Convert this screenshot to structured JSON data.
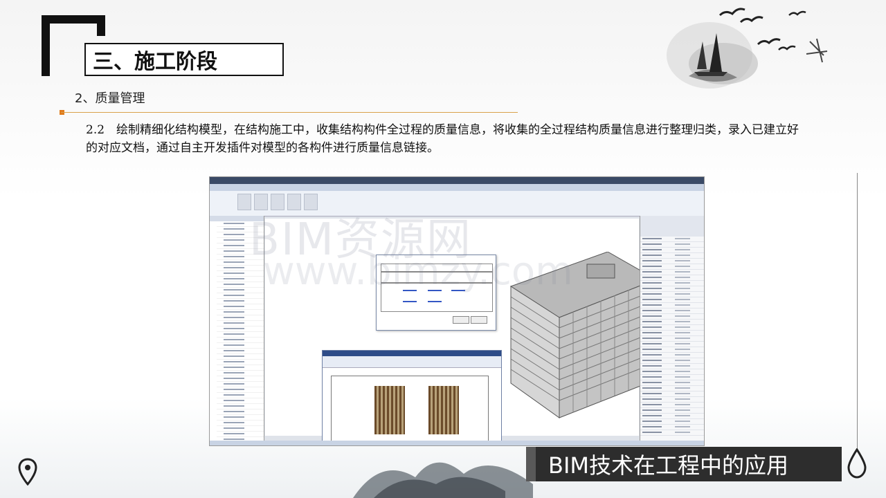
{
  "slide": {
    "title": "三、施工阶段",
    "subtitle": "2、质量管理",
    "paragraph": "2.2　绘制精细化结构模型，在结构施工中，收集结构构件全过程的质量信息，将收集的全过程结构质量信息进行整理归类，录入已建立好的对应文档，通过自主开发插件对模型的各构件进行质量信息链接。",
    "footer_tag": "BIM技术在工程中的应用",
    "watermark_top": "BIM资源网",
    "watermark_bottom": "www.bimzy.com"
  },
  "colors": {
    "accent_line": "#d9a04a",
    "accent_dot": "#e07b1c",
    "footer_bg": "#2d2d2d",
    "footer_border": "#595959"
  },
  "icons": [
    "location-pin-icon",
    "water-drop-icon",
    "sailboat-illustration",
    "birds-illustration",
    "ink-splash-decoration"
  ]
}
